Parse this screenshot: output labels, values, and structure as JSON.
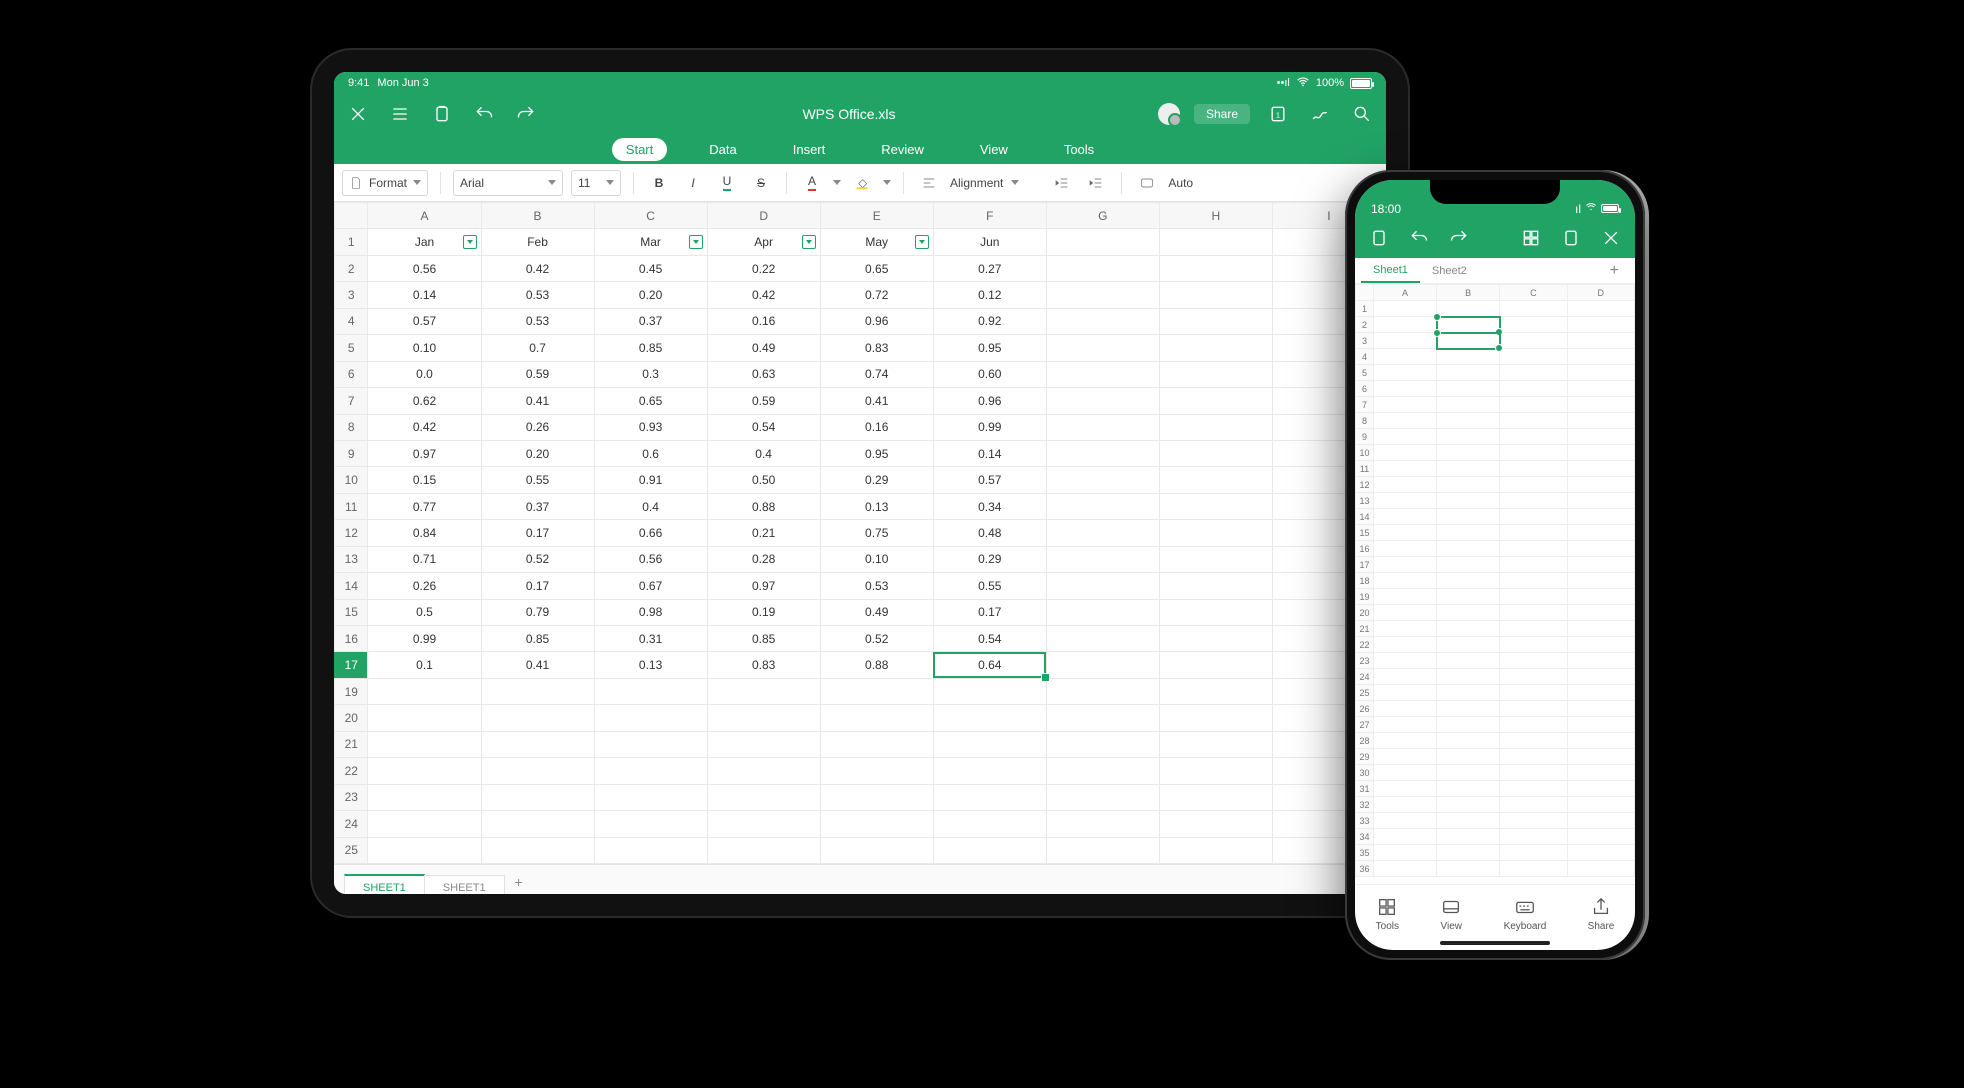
{
  "ipad": {
    "status": {
      "time": "9:41",
      "date": "Mon Jun 3",
      "battery": "100%",
      "signal": "••ll",
      "wifi": "wifi"
    },
    "titlebar": {
      "doc_title": "WPS Office.xls",
      "share_label": "Share"
    },
    "ribbon": {
      "tabs": [
        "Start",
        "Data",
        "Insert",
        "Review",
        "View",
        "Tools"
      ],
      "active": "Start"
    },
    "toolbar": {
      "format_label": "Format",
      "font_name": "Arial",
      "font_size": "11",
      "alignment_label": "Alignment",
      "auto_label": "Auto"
    },
    "sheet": {
      "columns": [
        "A",
        "B",
        "C",
        "D",
        "E",
        "F",
        "G",
        "H",
        "I"
      ],
      "header_row_months": [
        "Jan",
        "Feb",
        "Mar",
        "Apr",
        "May",
        "Jun"
      ],
      "filter_columns": [
        0,
        2,
        3,
        4
      ],
      "rows": [
        [
          "0.56",
          "0.42",
          "0.45",
          "0.22",
          "0.65",
          "0.27"
        ],
        [
          "0.14",
          "0.53",
          "0.20",
          "0.42",
          "0.72",
          "0.12"
        ],
        [
          "0.57",
          "0.53",
          "0.37",
          "0.16",
          "0.96",
          "0.92"
        ],
        [
          "0.10",
          "0.7",
          "0.85",
          "0.49",
          "0.83",
          "0.95"
        ],
        [
          "0.0",
          "0.59",
          "0.3",
          "0.63",
          "0.74",
          "0.60"
        ],
        [
          "0.62",
          "0.41",
          "0.65",
          "0.59",
          "0.41",
          "0.96"
        ],
        [
          "0.42",
          "0.26",
          "0.93",
          "0.54",
          "0.16",
          "0.99"
        ],
        [
          "0.97",
          "0.20",
          "0.6",
          "0.4",
          "0.95",
          "0.14"
        ],
        [
          "0.15",
          "0.55",
          "0.91",
          "0.50",
          "0.29",
          "0.57"
        ],
        [
          "0.77",
          "0.37",
          "0.4",
          "0.88",
          "0.13",
          "0.34"
        ],
        [
          "0.84",
          "0.17",
          "0.66",
          "0.21",
          "0.75",
          "0.48"
        ],
        [
          "0.71",
          "0.52",
          "0.56",
          "0.28",
          "0.10",
          "0.29"
        ],
        [
          "0.26",
          "0.17",
          "0.67",
          "0.97",
          "0.53",
          "0.55"
        ],
        [
          "0.5",
          "0.79",
          "0.98",
          "0.19",
          "0.49",
          "0.17"
        ],
        [
          "0.99",
          "0.85",
          "0.31",
          "0.85",
          "0.52",
          "0.54"
        ],
        [
          "0.1",
          "0.41",
          "0.13",
          "0.83",
          "0.88",
          "0.64"
        ]
      ],
      "empty_rows_after": [
        19,
        20,
        21,
        22,
        23,
        24,
        25
      ],
      "selected_cell": {
        "row": 17,
        "col": 5
      },
      "selected_col": 5,
      "selected_row": 17
    },
    "sheet_tabs": {
      "tabs": [
        "SHEET1",
        "SHEET1"
      ],
      "active": 0
    }
  },
  "iphone": {
    "status": {
      "time": "18:00"
    },
    "sheets": {
      "tabs": [
        "Sheet1",
        "Sheet2"
      ],
      "active": 0
    },
    "grid": {
      "columns": [
        "A",
        "B",
        "C",
        "D"
      ],
      "rows": 36,
      "selection": {
        "r0": 2,
        "c0": 1,
        "r1": 3,
        "c1": 1
      }
    },
    "bottom": {
      "tools": "Tools",
      "view": "View",
      "keyboard": "Keyboard",
      "share": "Share"
    }
  }
}
